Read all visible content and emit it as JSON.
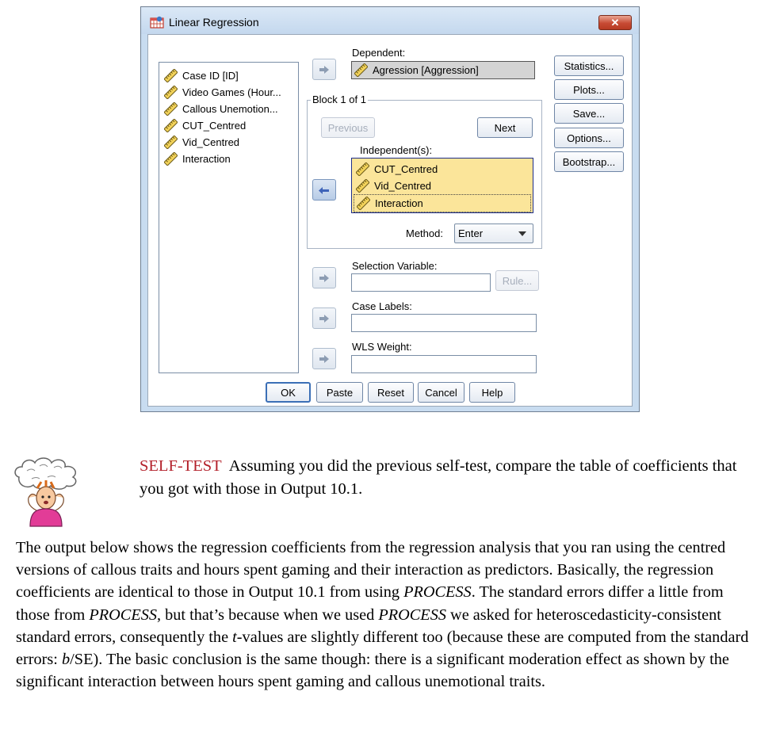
{
  "dialog": {
    "title": "Linear Regression",
    "close_glyph": "✕",
    "variables": [
      "Case ID [ID]",
      "Video Games (Hour...",
      "Callous Unemotion...",
      "CUT_Centred",
      "Vid_Centred",
      "Interaction"
    ],
    "dependent_label": "Dependent:",
    "dependent_value": "Agression [Aggression]",
    "block_label": "Block 1 of 1",
    "previous_button": "Previous",
    "next_button": "Next",
    "independent_label": "Independent(s):",
    "independent_items": [
      "CUT_Centred",
      "Vid_Centred",
      "Interaction"
    ],
    "method_label": "Method:",
    "method_value": "Enter",
    "selection_label": "Selection Variable:",
    "rule_button": "Rule...",
    "case_labels_label": "Case Labels:",
    "wls_label": "WLS Weight:",
    "side_buttons": [
      "Statistics...",
      "Plots...",
      "Save...",
      "Options...",
      "Bootstrap..."
    ],
    "bottom_buttons": [
      "OK",
      "Paste",
      "Reset",
      "Cancel",
      "Help"
    ]
  },
  "self_test": {
    "label": "SELF-TEST",
    "text": "Assuming you did the previous self-test, compare the table of coefficients that you got with those in Output 10.1."
  },
  "paragraph": {
    "s1": "The output below shows the regression coefficients from the regression analysis that you ran using the centred versions of callous traits and hours spent gaming and their interaction as predictors. Basically, the regression coefficients are identical to those in Output 10.1 from using ",
    "process1": "PROCESS",
    "s2": ". The standard errors differ a little from those from ",
    "process2": "PROCESS",
    "s3": ", but that’s because when we used ",
    "process3": "PROCESS",
    "s4": " we asked for heteroscedasticity-consistent standard errors, consequently the ",
    "t": "t",
    "s5": "-values are slightly different too (because these are computed from the standard errors: ",
    "b": "b",
    "s6": "/SE). The basic conclusion is the same though: there is a significant moderation effect as shown by the significant interaction between hours spent gaming and callous unemotional traits."
  },
  "colors": {
    "highlight": "#fbe59a",
    "highlight_border": "#1f2f8a",
    "selftest_red": "#b3202a",
    "window_frame": "#c8dcf0"
  }
}
